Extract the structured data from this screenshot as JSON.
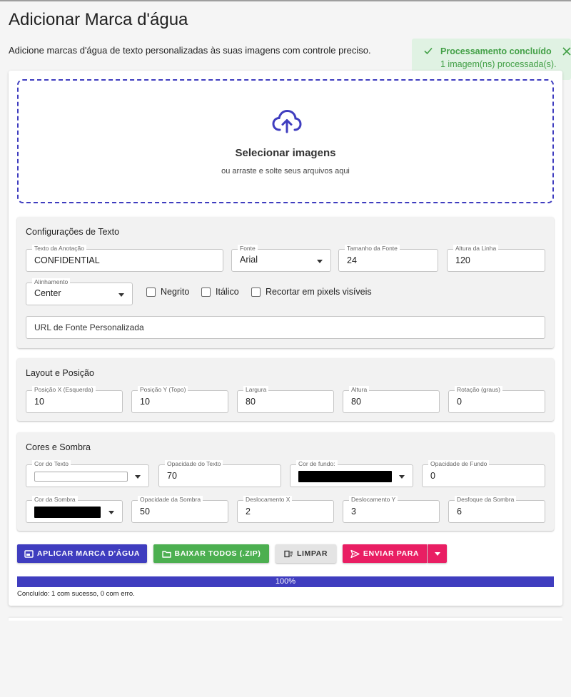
{
  "page": {
    "title": "Adicionar Marca d'água",
    "description": "Adicione marcas d'água de texto personalizadas às suas imagens com controle preciso."
  },
  "toast": {
    "title": "Processamento concluído",
    "message": "1 imagem(ns) processada(s).",
    "color": "#43a047"
  },
  "dropzone": {
    "title": "Selecionar imagens",
    "subtitle": "ou arraste e solte seus arquivos aqui",
    "icon": "cloud-upload-icon"
  },
  "text_settings": {
    "title": "Configurações de Texto",
    "annotation_text": {
      "label": "Texto da Anotação",
      "value": "CONFIDENTIAL"
    },
    "font": {
      "label": "Fonte",
      "value": "Arial"
    },
    "font_size": {
      "label": "Tamanho da Fonte",
      "value": "24"
    },
    "line_height": {
      "label": "Altura da Linha",
      "value": "120"
    },
    "alignment": {
      "label": "Alinhamento",
      "value": "Center"
    },
    "bold_label": "Negrito",
    "italic_label": "Itálico",
    "crop_label": "Recortar em pixels visíveis",
    "custom_font_placeholder": "URL de Fonte Personalizada"
  },
  "layout": {
    "title": "Layout e Posição",
    "pos_x": {
      "label": "Posição X (Esquerda)",
      "value": "10"
    },
    "pos_y": {
      "label": "Posição Y (Topo)",
      "value": "10"
    },
    "width": {
      "label": "Largura",
      "value": "80"
    },
    "height": {
      "label": "Altura",
      "value": "80"
    },
    "rotation": {
      "label": "Rotação (graus)",
      "value": "0"
    }
  },
  "colors": {
    "title": "Cores e Sombra",
    "text_color": {
      "label": "Cor do Texto",
      "value": "#ffffff"
    },
    "text_opacity": {
      "label": "Opacidade do Texto",
      "value": "70"
    },
    "bg_color": {
      "label": "Cor de fundo:",
      "value": "#000000"
    },
    "bg_opacity": {
      "label": "Opacidade de Fundo",
      "value": "0"
    },
    "shadow_color": {
      "label": "Cor da Sombra",
      "value": "#000000"
    },
    "shadow_opacity": {
      "label": "Opacidade da Sombra",
      "value": "50"
    },
    "offset_x": {
      "label": "Deslocamento X",
      "value": "2"
    },
    "offset_y": {
      "label": "Deslocamento Y",
      "value": "3"
    },
    "shadow_blur": {
      "label": "Desfoque da Sombra",
      "value": "6"
    }
  },
  "actions": {
    "apply": "APLICAR MARCA D'ÁGUA",
    "download_zip": "BAIXAR TODOS (.ZIP)",
    "clear": "LIMPAR",
    "send_to": "ENVIAR PARA"
  },
  "progress": {
    "percent": 100,
    "label": "100%",
    "status": "Concluído: 1 com sucesso, 0 com erro."
  },
  "theme": {
    "primary": "#3f3dbf",
    "success": "#4caf50",
    "accent": "#e91e63"
  }
}
